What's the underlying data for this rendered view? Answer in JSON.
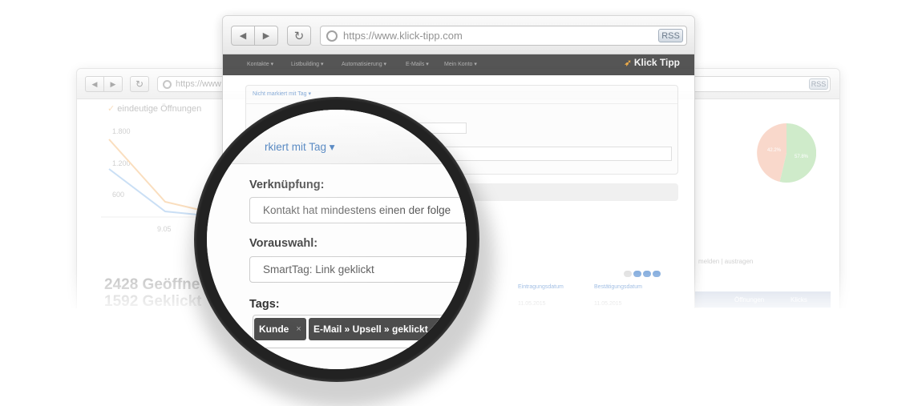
{
  "front_window": {
    "url": "https://www.klick-tipp.com",
    "rss_label": "RSS",
    "logo_text": "Klick Tipp",
    "menu_items": [
      "Kontakte ▾",
      "Listbuilding ▾",
      "Automatisierung ▾",
      "E-Mails ▾",
      "Mein Konto ▾"
    ],
    "filter_link": "Nicht markiert mit Tag ▾",
    "table_headers": [
      "Eintragungsdatum",
      "Bestätigungsdatum"
    ],
    "table_row": [
      "11.05.2015",
      "11.05.2015"
    ]
  },
  "back_window": {
    "url": "https://www",
    "rss_label": "RSS",
    "legend_label": "eindeutige Öffnungen",
    "y_ticks": [
      "1.800",
      "1.200",
      "600"
    ],
    "x_tick": "9.05",
    "stat_opens": "2428 Geöffne",
    "stat_clicks": "1592 Geklickt",
    "pie_labels": [
      "42.2%",
      "57.8%"
    ],
    "right_link_text": "melden | austragen",
    "right_table_headers": [
      "Öffnungen",
      "Klicks"
    ]
  },
  "magnifier": {
    "filter_link": "rkiert mit Tag ▾",
    "link_label": "Verknüpfung:",
    "link_value": "Kontakt hat mindestens einen der folge",
    "preselect_label": "Vorauswahl:",
    "preselect_value": "SmartTag: Link geklickt",
    "tags_label": "Tags:",
    "tags": [
      {
        "label": "Kunde",
        "remove": "×"
      },
      {
        "label": "E-Mail » Upsell » geklickt",
        "remove": "×"
      }
    ]
  },
  "colors": {
    "appbar": "#474747",
    "link_blue": "#3a74b8",
    "tag_bg": "#4d4d4d",
    "chart_orange": "#f7c48a",
    "chart_blue": "#9fc6ee",
    "pie_green": "#a8dba0",
    "pie_salmon": "#f5b9a2"
  }
}
